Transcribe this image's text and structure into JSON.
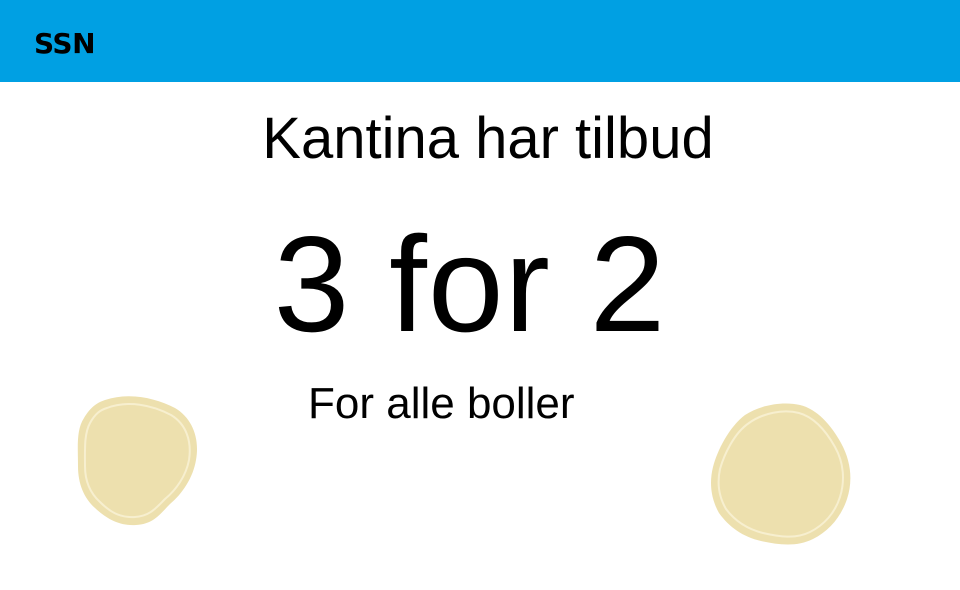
{
  "header": {
    "logo_text": "SSN",
    "background_color": "#00a0e3"
  },
  "slide": {
    "headline": "Kantina har tilbud",
    "offer": "3 for 2",
    "subline": "For alle boller"
  },
  "decorations": {
    "bun_color": "#ede0ae",
    "bun_highlight": "#f7efcf",
    "icons": [
      "bun-left-icon",
      "bun-right-icon"
    ]
  }
}
